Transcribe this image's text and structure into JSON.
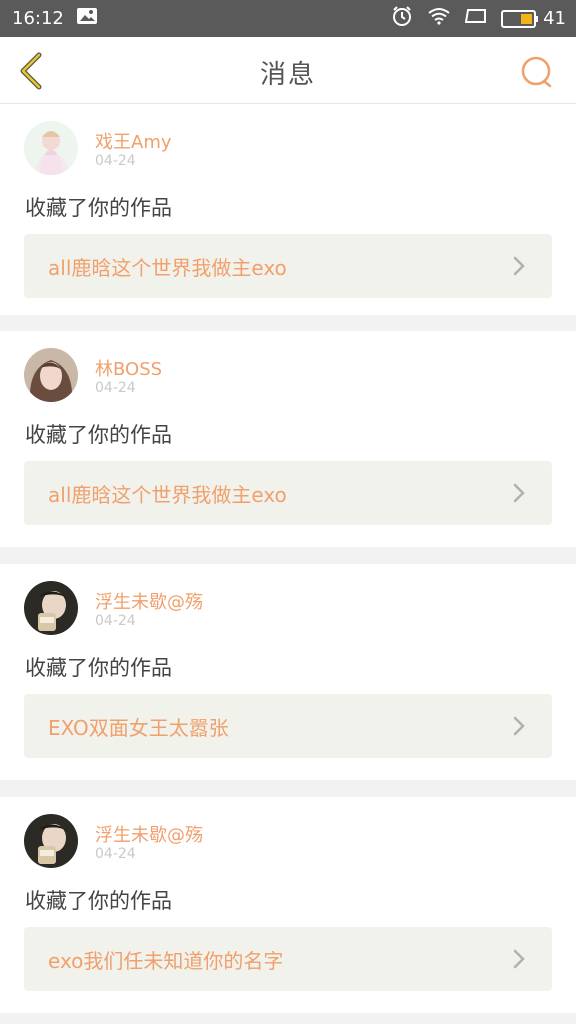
{
  "status_bar": {
    "time": "16:12",
    "battery": "41",
    "icons": [
      "image-icon",
      "alarm-icon",
      "wifi-icon",
      "signal-icon",
      "battery-icon"
    ]
  },
  "nav": {
    "title": "消息",
    "back_icon": "back-chevron-icon",
    "search_icon": "search-icon",
    "accent": "#f0a06c",
    "back_color": "#e8c53d"
  },
  "notifications": [
    {
      "username": "戏王Amy",
      "date": "04-24",
      "action": "收藏了你的作品",
      "work_title": "all鹿晗这个世界我做主exo"
    },
    {
      "username": "林BOSS",
      "date": "04-24",
      "action": "收藏了你的作品",
      "work_title": "all鹿晗这个世界我做主exo"
    },
    {
      "username": "浮生未歇@殇",
      "date": "04-24",
      "action": "收藏了你的作品",
      "work_title": "EXO双面女王太嚣张"
    },
    {
      "username": "浮生未歇@殇",
      "date": "04-24",
      "action": "收藏了你的作品",
      "work_title": "exo我们任未知道你的名字"
    }
  ]
}
